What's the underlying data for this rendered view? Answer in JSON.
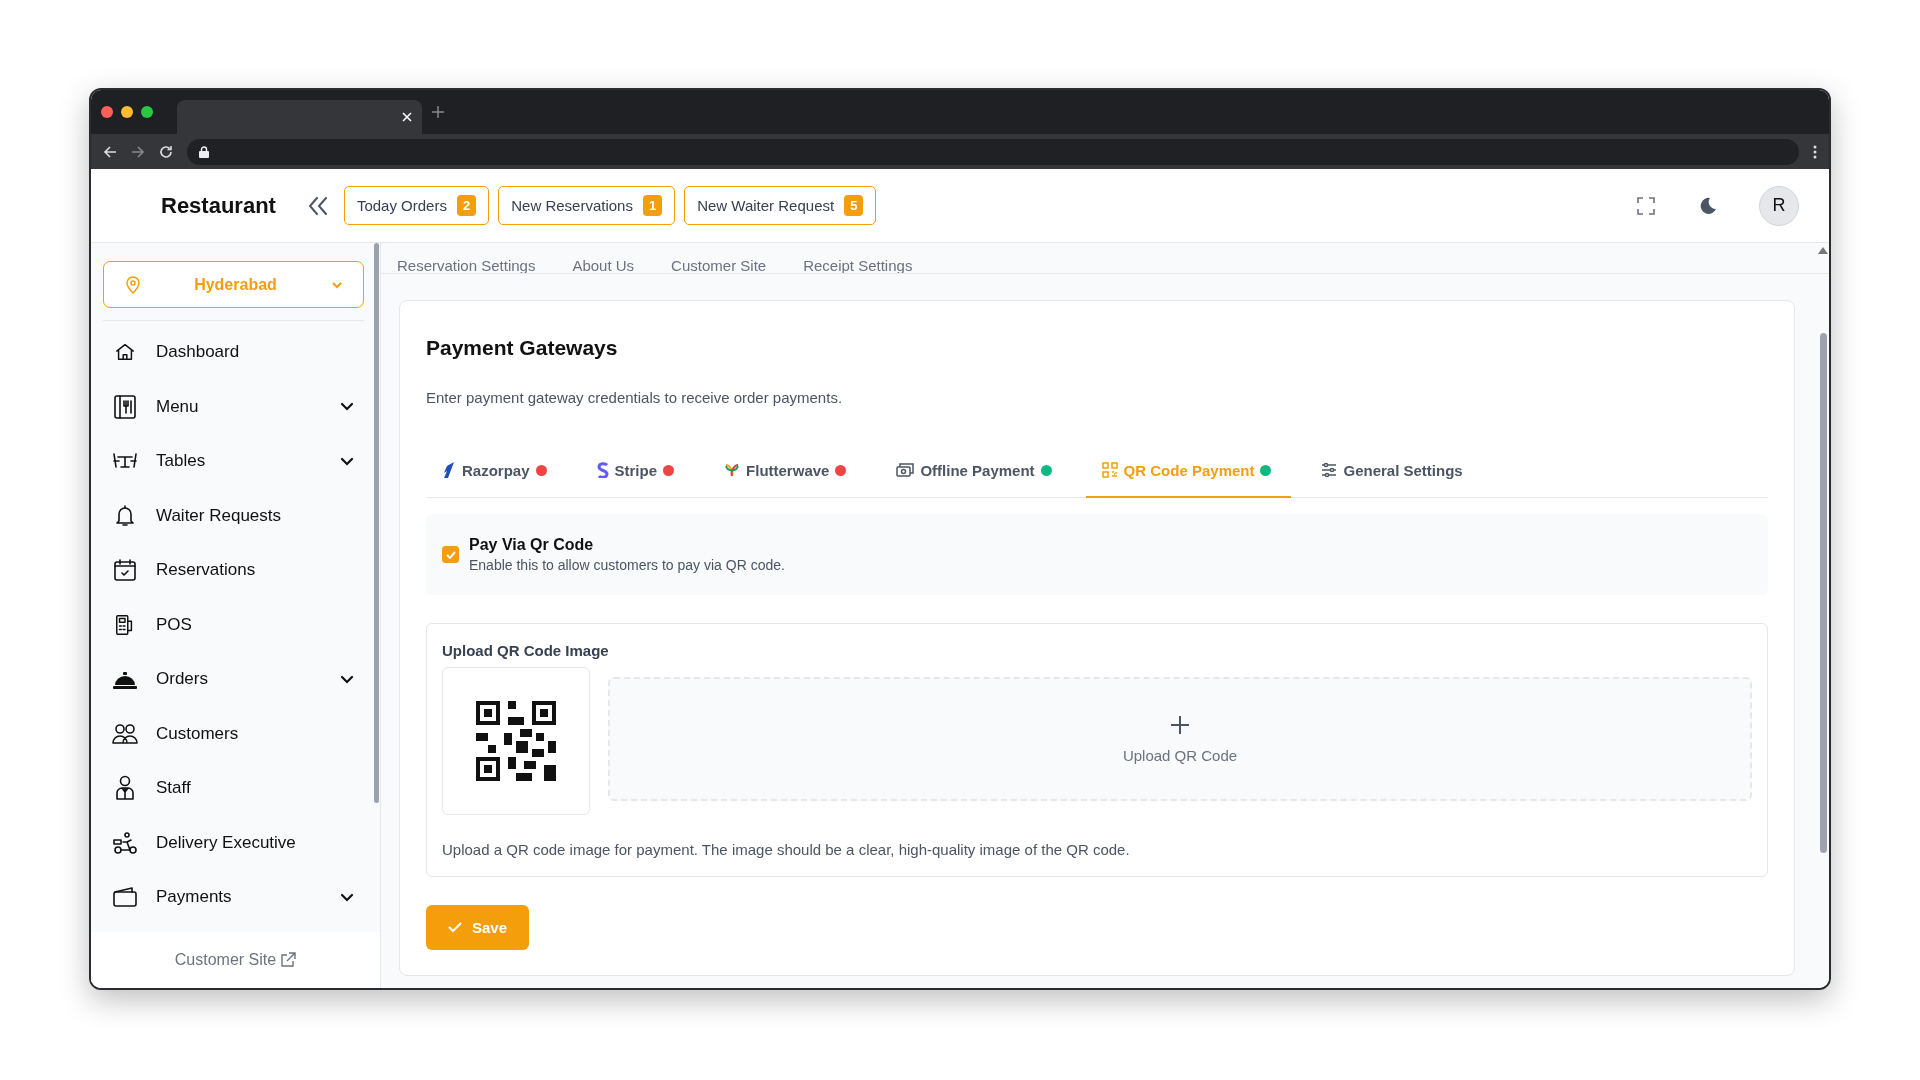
{
  "header": {
    "brand": "Restaurant",
    "buttons": [
      {
        "label": "Today Orders",
        "count": "2"
      },
      {
        "label": "New Reservations",
        "count": "1"
      },
      {
        "label": "New Waiter Request",
        "count": "5"
      }
    ],
    "avatar": "R"
  },
  "sidebar": {
    "location": "Hyderabad",
    "items": [
      {
        "label": "Dashboard",
        "has_submenu": false
      },
      {
        "label": "Menu",
        "has_submenu": true
      },
      {
        "label": "Tables",
        "has_submenu": true
      },
      {
        "label": "Waiter Requests",
        "has_submenu": false
      },
      {
        "label": "Reservations",
        "has_submenu": false
      },
      {
        "label": "POS",
        "has_submenu": false
      },
      {
        "label": "Orders",
        "has_submenu": true
      },
      {
        "label": "Customers",
        "has_submenu": false
      },
      {
        "label": "Staff",
        "has_submenu": false
      },
      {
        "label": "Delivery Executive",
        "has_submenu": false
      },
      {
        "label": "Payments",
        "has_submenu": true
      }
    ],
    "footer_link": "Customer Site"
  },
  "settings_tabs": [
    "Reservation Settings",
    "About Us",
    "Customer Site",
    "Receipt Settings"
  ],
  "page": {
    "title": "Payment Gateways",
    "description": "Enter payment gateway credentials to receive order payments.",
    "gateway_tabs": [
      {
        "label": "Razorpay",
        "color": "#ef4444",
        "selected": false
      },
      {
        "label": "Stripe",
        "color": "#ef4444",
        "selected": false
      },
      {
        "label": "Flutterwave",
        "color": "#ef4444",
        "selected": false
      },
      {
        "label": "Offline Payment",
        "color": "#10b981",
        "selected": false
      },
      {
        "label": "QR Code Payment",
        "color": "#10b981",
        "selected": true
      },
      {
        "label": "General Settings",
        "selected": false
      }
    ],
    "toggle": {
      "label": "Pay Via Qr Code",
      "hint": "Enable this to allow customers to pay via QR code.",
      "checked": true
    },
    "upload": {
      "title": "Upload QR Code Image",
      "button": "Upload QR Code",
      "help": "Upload a QR code image for payment. The image should be a clear, high-quality image of the QR code."
    },
    "save": "Save"
  }
}
